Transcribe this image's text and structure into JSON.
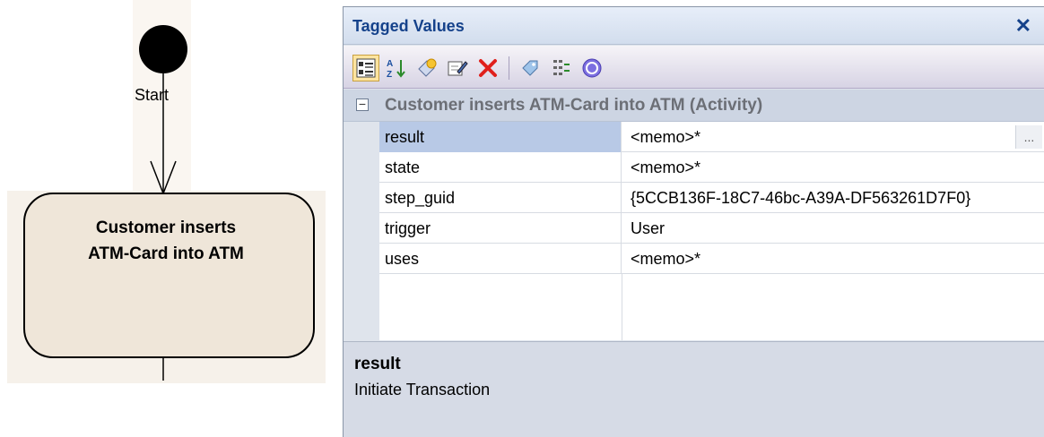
{
  "diagram": {
    "start_label": "Start",
    "activity_label_line1": "Customer inserts",
    "activity_label_line2": "ATM-Card into ATM"
  },
  "tagged_values": {
    "title": "Tagged Values",
    "close_glyph": "✕",
    "toolbar": [
      {
        "name": "categorized-view-icon",
        "active": true
      },
      {
        "name": "sort-alphabetical-icon"
      },
      {
        "name": "new-tag-icon"
      },
      {
        "name": "edit-note-icon"
      },
      {
        "name": "delete-icon"
      },
      {
        "name": "tag-icon"
      },
      {
        "name": "list-icon"
      },
      {
        "name": "help-icon"
      }
    ],
    "group": {
      "toggle": "−",
      "label": "Customer inserts ATM-Card into ATM (Activity)"
    },
    "rows": [
      {
        "name": "result",
        "value": "<memo>*",
        "selected": true
      },
      {
        "name": "state",
        "value": "<memo>*"
      },
      {
        "name": "step_guid",
        "value": "{5CCB136F-18C7-46bc-A39A-DF563261D7F0}"
      },
      {
        "name": "trigger",
        "value": "User"
      },
      {
        "name": "uses",
        "value": "<memo>*"
      }
    ],
    "ellipsis": "...",
    "description": {
      "title": "result",
      "text": "Initiate Transaction"
    }
  }
}
